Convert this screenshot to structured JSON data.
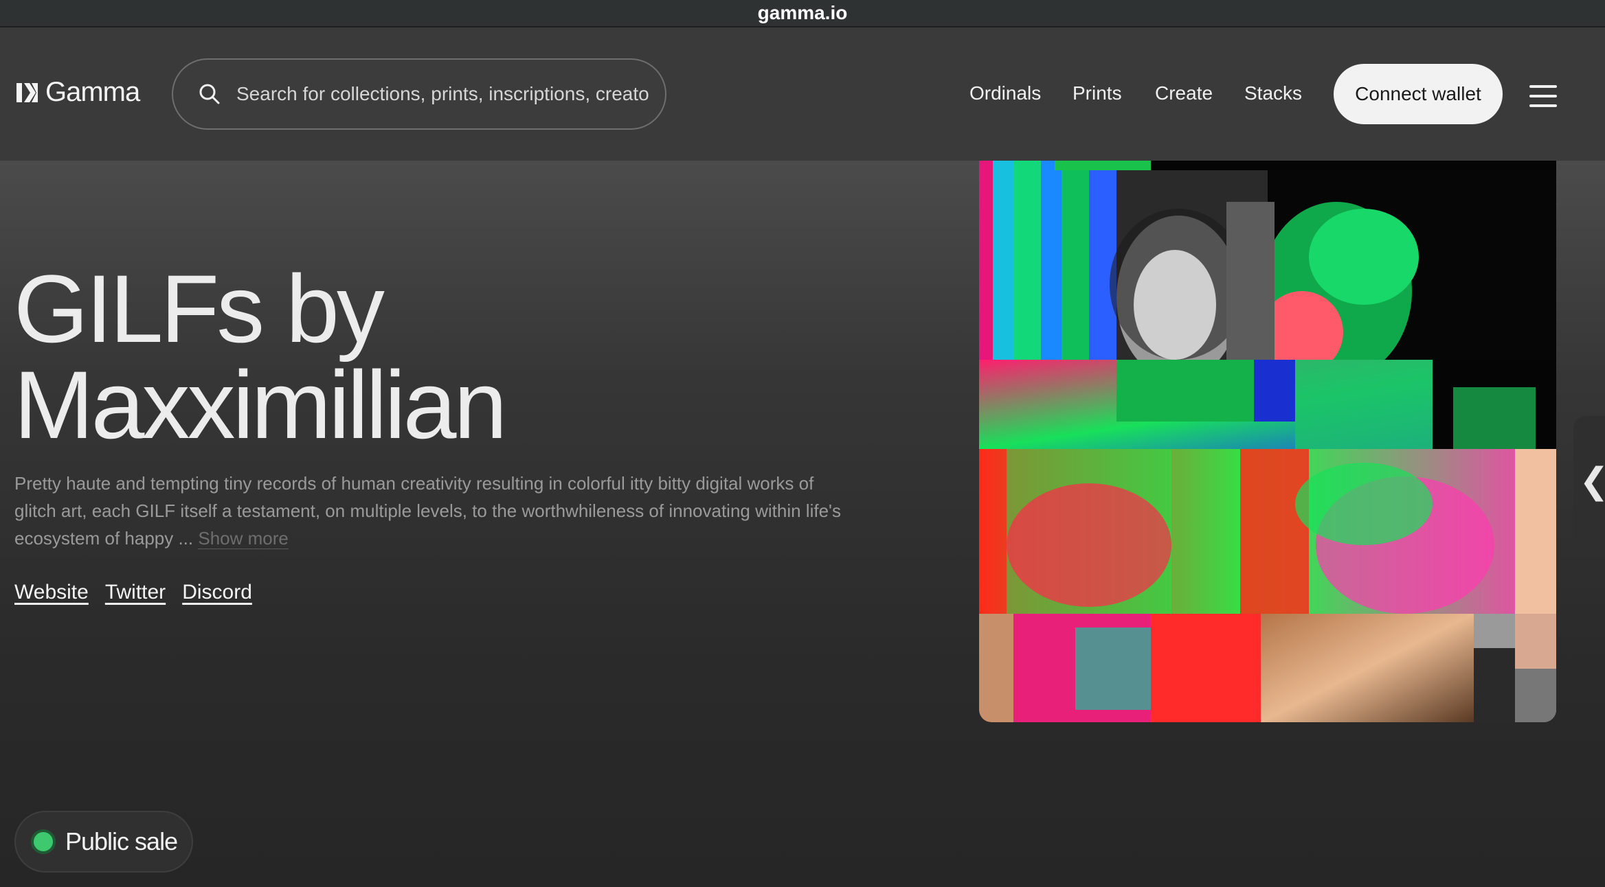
{
  "browser": {
    "url": "gamma.io"
  },
  "nav": {
    "logo_text": "Gamma",
    "search_placeholder": "Search for collections, prints, inscriptions, creato",
    "links": [
      "Ordinals",
      "Prints",
      "Create",
      "Stacks"
    ],
    "connect_label": "Connect wallet"
  },
  "hero": {
    "title_line1": "GILFs by",
    "title_line2": "Maxximillian",
    "description": "Pretty haute and tempting tiny records of human creativity resulting in colorful itty bitty digital works of glitch art, each GILF itself a testament, on multiple levels, to the worthwhileness of innovating within life's ecosystem of happy ...",
    "show_more": "Show more",
    "links": [
      "Website",
      "Twitter",
      "Discord"
    ]
  },
  "side_tab": {
    "glyph": "❮"
  },
  "status": {
    "label": "Public sale",
    "color": "#3ec96e"
  },
  "icons": [
    "gamma-logo-icon",
    "search-icon",
    "hamburger-menu-icon",
    "chevron-left-icon",
    "status-dot-icon"
  ]
}
